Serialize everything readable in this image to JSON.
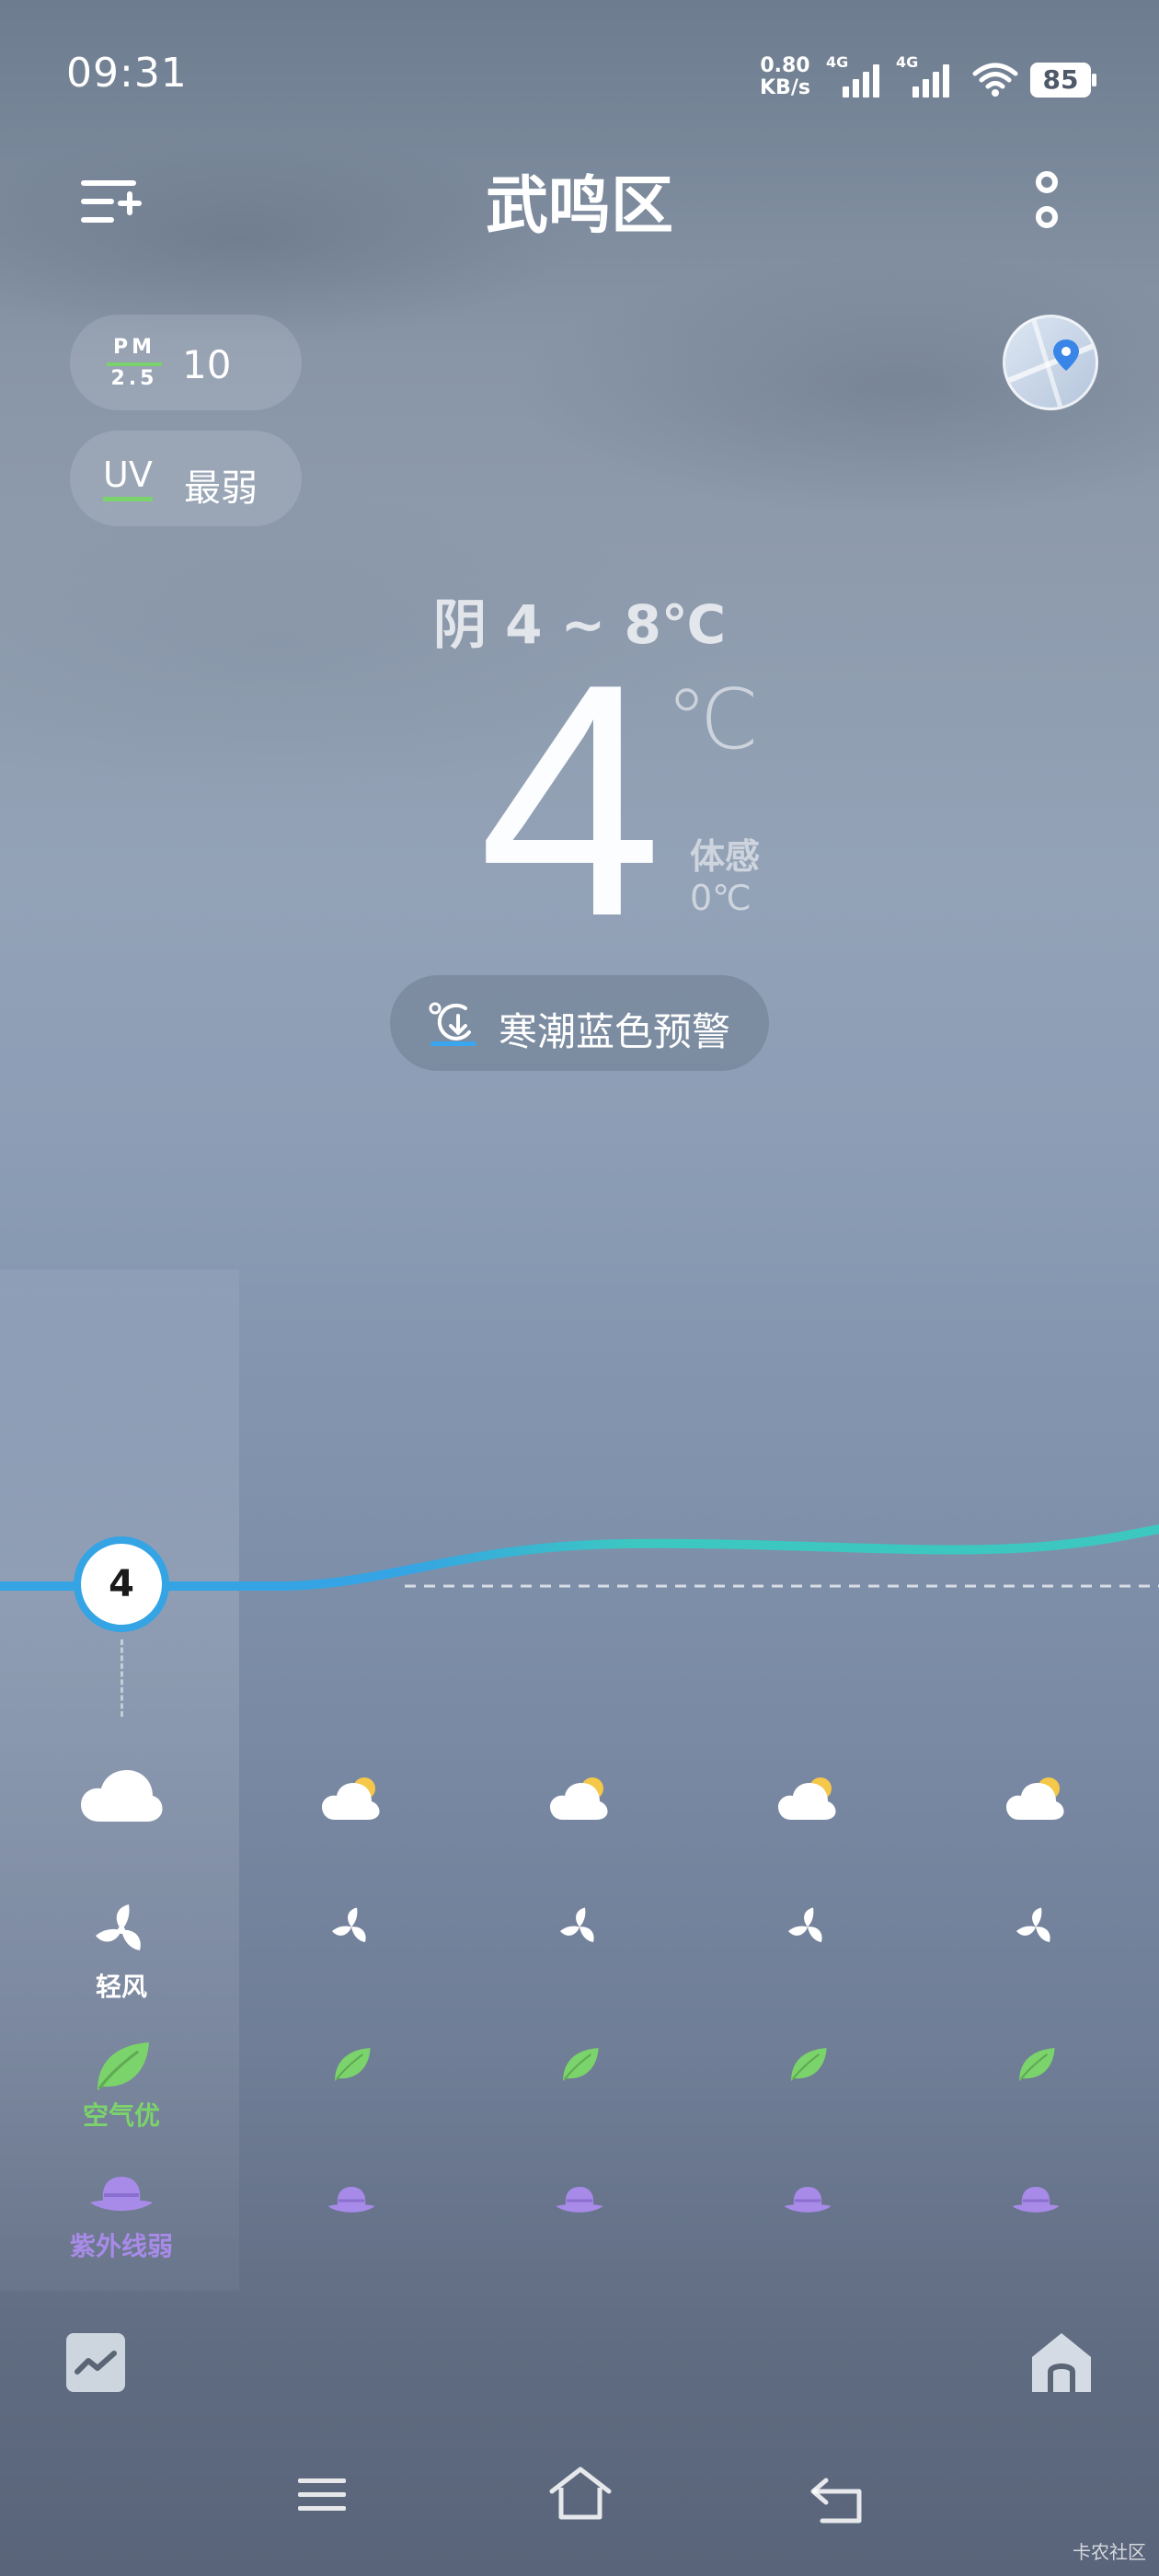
{
  "status_bar": {
    "time": "09:31",
    "net_speed_value": "0.80",
    "net_speed_unit": "KB/s",
    "sim1_label": "4G",
    "sim2_label": "4G",
    "battery": "85"
  },
  "header": {
    "city": "武鸣区",
    "menu_icon": "add-city-list-icon",
    "more_icon": "more-vertical-icon"
  },
  "indices": {
    "pm_label_top": "PM",
    "pm_label_bottom": "2.5",
    "pm_value": "10",
    "uv_label": "UV",
    "uv_value": "最弱",
    "map_icon": "map-location-icon"
  },
  "current": {
    "condition_range": "阴  4 ~ 8℃",
    "temp": "4",
    "unit": "℃",
    "feels_label": "体感",
    "feels_value": "0℃"
  },
  "alert": {
    "text": "寒潮蓝色预警",
    "icon": "cold-wave-warning-icon"
  },
  "hourly": {
    "now_temp": "4",
    "now_wind": "轻风",
    "now_air": "空气优",
    "now_uv": "紫外线弱",
    "columns": 5,
    "colors": {
      "curve_start": "#35a4e4",
      "curve_end": "#3cc8c0",
      "air_green": "#7bd36b",
      "uv_purple": "#a88be8"
    }
  },
  "bottom": {
    "trend_icon": "trend-chart-icon",
    "home_icon": "home-icon"
  },
  "nav_bar": {
    "menu_icon": "menu-icon",
    "home_icon": "home-nav-icon",
    "back_icon": "back-icon"
  },
  "watermark": "卡农社区"
}
